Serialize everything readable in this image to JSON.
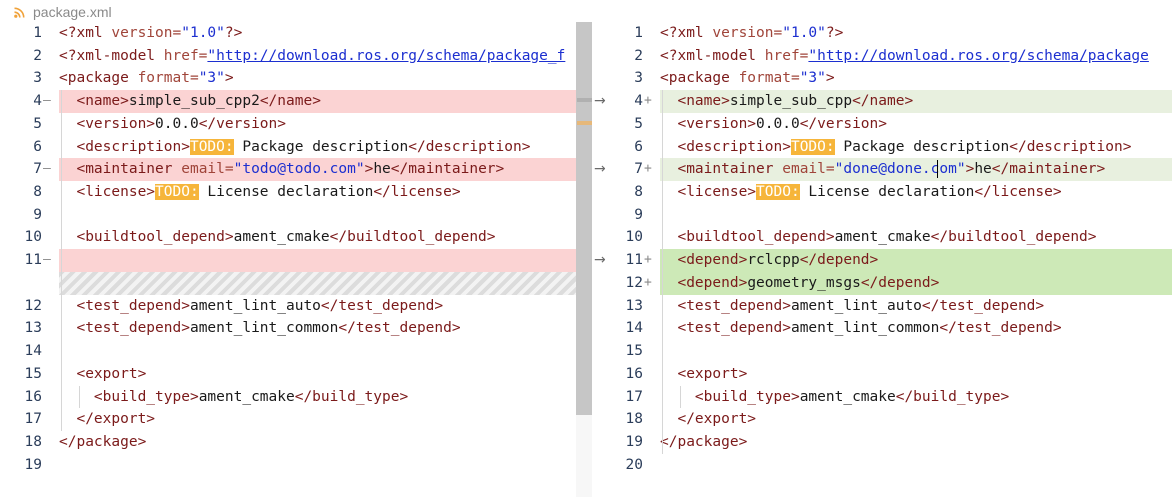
{
  "tab": {
    "title": "package.xml",
    "icon": "rss-icon"
  },
  "colors": {
    "deleted": "#fbd3d3",
    "added": "#cde9b7",
    "modified": "#e8f0df",
    "todo": "#f6b53a"
  },
  "left": [
    {
      "ln": "1",
      "mk": "",
      "type": "",
      "code": [
        [
          "pi",
          "<?xml "
        ],
        [
          "attr",
          "version="
        ],
        [
          "str",
          "\"1.0\""
        ],
        [
          "pi",
          "?>"
        ]
      ]
    },
    {
      "ln": "2",
      "mk": "",
      "type": "",
      "code": [
        [
          "pi",
          "<?xml-model "
        ],
        [
          "attr",
          "href="
        ],
        [
          "strul",
          "\"http://download.ros.org/schema/package_f"
        ]
      ]
    },
    {
      "ln": "3",
      "mk": "",
      "type": "",
      "code": [
        [
          "tag",
          "<package "
        ],
        [
          "attr",
          "format="
        ],
        [
          "str",
          "\"3\""
        ],
        [
          "tag",
          ">"
        ]
      ]
    },
    {
      "ln": "4",
      "mk": "—",
      "type": "del",
      "code": [
        [
          "text",
          "  "
        ],
        [
          "tag",
          "<name>"
        ],
        [
          "text",
          "simple_sub_cpp2"
        ],
        [
          "tag",
          "</name>"
        ]
      ]
    },
    {
      "ln": "5",
      "mk": "",
      "type": "",
      "code": [
        [
          "text",
          "  "
        ],
        [
          "tag",
          "<version>"
        ],
        [
          "text",
          "0.0.0"
        ],
        [
          "tag",
          "</version>"
        ]
      ]
    },
    {
      "ln": "6",
      "mk": "",
      "type": "",
      "code": [
        [
          "text",
          "  "
        ],
        [
          "tag",
          "<description>"
        ],
        [
          "todo",
          "TODO:"
        ],
        [
          "text",
          " Package description"
        ],
        [
          "tag",
          "</description>"
        ]
      ]
    },
    {
      "ln": "7",
      "mk": "—",
      "type": "del",
      "code": [
        [
          "text",
          "  "
        ],
        [
          "tag",
          "<maintainer "
        ],
        [
          "attr",
          "email="
        ],
        [
          "str",
          "\"todo@todo.com\""
        ],
        [
          "tag",
          ">"
        ],
        [
          "text",
          "he"
        ],
        [
          "tag",
          "</maintainer>"
        ]
      ]
    },
    {
      "ln": "8",
      "mk": "",
      "type": "",
      "code": [
        [
          "text",
          "  "
        ],
        [
          "tag",
          "<license>"
        ],
        [
          "todo",
          "TODO:"
        ],
        [
          "text",
          " License declaration"
        ],
        [
          "tag",
          "</license>"
        ]
      ]
    },
    {
      "ln": "9",
      "mk": "",
      "type": "",
      "code": []
    },
    {
      "ln": "10",
      "mk": "",
      "type": "",
      "code": [
        [
          "text",
          "  "
        ],
        [
          "tag",
          "<buildtool_depend>"
        ],
        [
          "text",
          "ament_cmake"
        ],
        [
          "tag",
          "</buildtool_depend>"
        ]
      ]
    },
    {
      "ln": "11",
      "mk": "—",
      "type": "del",
      "code": []
    },
    {
      "ln": "",
      "mk": "",
      "type": "hatch",
      "code": []
    },
    {
      "ln": "12",
      "mk": "",
      "type": "",
      "code": [
        [
          "text",
          "  "
        ],
        [
          "tag",
          "<test_depend>"
        ],
        [
          "text",
          "ament_lint_auto"
        ],
        [
          "tag",
          "</test_depend>"
        ]
      ]
    },
    {
      "ln": "13",
      "mk": "",
      "type": "",
      "code": [
        [
          "text",
          "  "
        ],
        [
          "tag",
          "<test_depend>"
        ],
        [
          "text",
          "ament_lint_common"
        ],
        [
          "tag",
          "</test_depend>"
        ]
      ]
    },
    {
      "ln": "14",
      "mk": "",
      "type": "",
      "code": []
    },
    {
      "ln": "15",
      "mk": "",
      "type": "",
      "code": [
        [
          "text",
          "  "
        ],
        [
          "tag",
          "<export>"
        ]
      ]
    },
    {
      "ln": "16",
      "mk": "",
      "type": "",
      "code": [
        [
          "text",
          "    "
        ],
        [
          "tag",
          "<build_type>"
        ],
        [
          "text",
          "ament_cmake"
        ],
        [
          "tag",
          "</build_type>"
        ]
      ]
    },
    {
      "ln": "17",
      "mk": "",
      "type": "",
      "code": [
        [
          "text",
          "  "
        ],
        [
          "tag",
          "</export>"
        ]
      ]
    },
    {
      "ln": "18",
      "mk": "",
      "type": "",
      "code": [
        [
          "tag",
          "</package>"
        ]
      ]
    },
    {
      "ln": "19",
      "mk": "",
      "type": "",
      "code": []
    }
  ],
  "right": [
    {
      "ln": "1",
      "mk": "",
      "type": "",
      "code": [
        [
          "pi",
          "<?xml "
        ],
        [
          "attr",
          "version="
        ],
        [
          "str",
          "\"1.0\""
        ],
        [
          "pi",
          "?>"
        ]
      ]
    },
    {
      "ln": "2",
      "mk": "",
      "type": "",
      "code": [
        [
          "pi",
          "<?xml-model "
        ],
        [
          "attr",
          "href="
        ],
        [
          "strul",
          "\"http://download.ros.org/schema/package"
        ]
      ]
    },
    {
      "ln": "3",
      "mk": "",
      "type": "",
      "code": [
        [
          "tag",
          "<package "
        ],
        [
          "attr",
          "format="
        ],
        [
          "str",
          "\"3\""
        ],
        [
          "tag",
          ">"
        ]
      ]
    },
    {
      "ln": "4",
      "mk": "+",
      "type": "mod",
      "code": [
        [
          "text",
          "  "
        ],
        [
          "tag",
          "<name>"
        ],
        [
          "text",
          "simple_sub_cpp"
        ],
        [
          "tag",
          "</name>"
        ]
      ]
    },
    {
      "ln": "5",
      "mk": "",
      "type": "",
      "code": [
        [
          "text",
          "  "
        ],
        [
          "tag",
          "<version>"
        ],
        [
          "text",
          "0.0.0"
        ],
        [
          "tag",
          "</version>"
        ]
      ]
    },
    {
      "ln": "6",
      "mk": "",
      "type": "",
      "code": [
        [
          "text",
          "  "
        ],
        [
          "tag",
          "<description>"
        ],
        [
          "todo",
          "TODO:"
        ],
        [
          "text",
          " Package description"
        ],
        [
          "tag",
          "</description>"
        ]
      ]
    },
    {
      "ln": "7",
      "mk": "+",
      "type": "mod",
      "code": [
        [
          "text",
          "  "
        ],
        [
          "tag",
          "<maintainer "
        ],
        [
          "attr",
          "email="
        ],
        [
          "str",
          "\"done@done.com\""
        ],
        [
          "tag",
          ">"
        ],
        [
          "text",
          "he"
        ],
        [
          "tag",
          "</maintainer>"
        ]
      ]
    },
    {
      "ln": "8",
      "mk": "",
      "type": "",
      "code": [
        [
          "text",
          "  "
        ],
        [
          "tag",
          "<license>"
        ],
        [
          "todo",
          "TODO:"
        ],
        [
          "text",
          " License declaration"
        ],
        [
          "tag",
          "</license>"
        ]
      ]
    },
    {
      "ln": "9",
      "mk": "",
      "type": "",
      "code": []
    },
    {
      "ln": "10",
      "mk": "",
      "type": "",
      "code": [
        [
          "text",
          "  "
        ],
        [
          "tag",
          "<buildtool_depend>"
        ],
        [
          "text",
          "ament_cmake"
        ],
        [
          "tag",
          "</buildtool_depend>"
        ]
      ]
    },
    {
      "ln": "11",
      "mk": "+",
      "type": "ins",
      "code": [
        [
          "text",
          "  "
        ],
        [
          "tag",
          "<depend>"
        ],
        [
          "text",
          "rclcpp"
        ],
        [
          "tag",
          "</depend>"
        ]
      ]
    },
    {
      "ln": "12",
      "mk": "+",
      "type": "ins",
      "code": [
        [
          "text",
          "  "
        ],
        [
          "tag",
          "<depend>"
        ],
        [
          "text",
          "geometry_msgs"
        ],
        [
          "tag",
          "</depend>"
        ]
      ]
    },
    {
      "ln": "13",
      "mk": "",
      "type": "",
      "code": [
        [
          "text",
          "  "
        ],
        [
          "tag",
          "<test_depend>"
        ],
        [
          "text",
          "ament_lint_auto"
        ],
        [
          "tag",
          "</test_depend>"
        ]
      ]
    },
    {
      "ln": "14",
      "mk": "",
      "type": "",
      "code": [
        [
          "text",
          "  "
        ],
        [
          "tag",
          "<test_depend>"
        ],
        [
          "text",
          "ament_lint_common"
        ],
        [
          "tag",
          "</test_depend>"
        ]
      ]
    },
    {
      "ln": "15",
      "mk": "",
      "type": "",
      "code": []
    },
    {
      "ln": "16",
      "mk": "",
      "type": "",
      "code": [
        [
          "text",
          "  "
        ],
        [
          "tag",
          "<export>"
        ]
      ]
    },
    {
      "ln": "17",
      "mk": "",
      "type": "",
      "code": [
        [
          "text",
          "    "
        ],
        [
          "tag",
          "<build_type>"
        ],
        [
          "text",
          "ament_cmake"
        ],
        [
          "tag",
          "</build_type>"
        ]
      ]
    },
    {
      "ln": "18",
      "mk": "",
      "type": "",
      "code": [
        [
          "text",
          "  "
        ],
        [
          "tag",
          "</export>"
        ]
      ]
    },
    {
      "ln": "19",
      "mk": "",
      "type": "",
      "code": [
        [
          "tag",
          "</package>"
        ]
      ]
    },
    {
      "ln": "20",
      "mk": "",
      "type": "",
      "code": []
    }
  ],
  "arrows": [
    "→",
    "→",
    "→"
  ]
}
